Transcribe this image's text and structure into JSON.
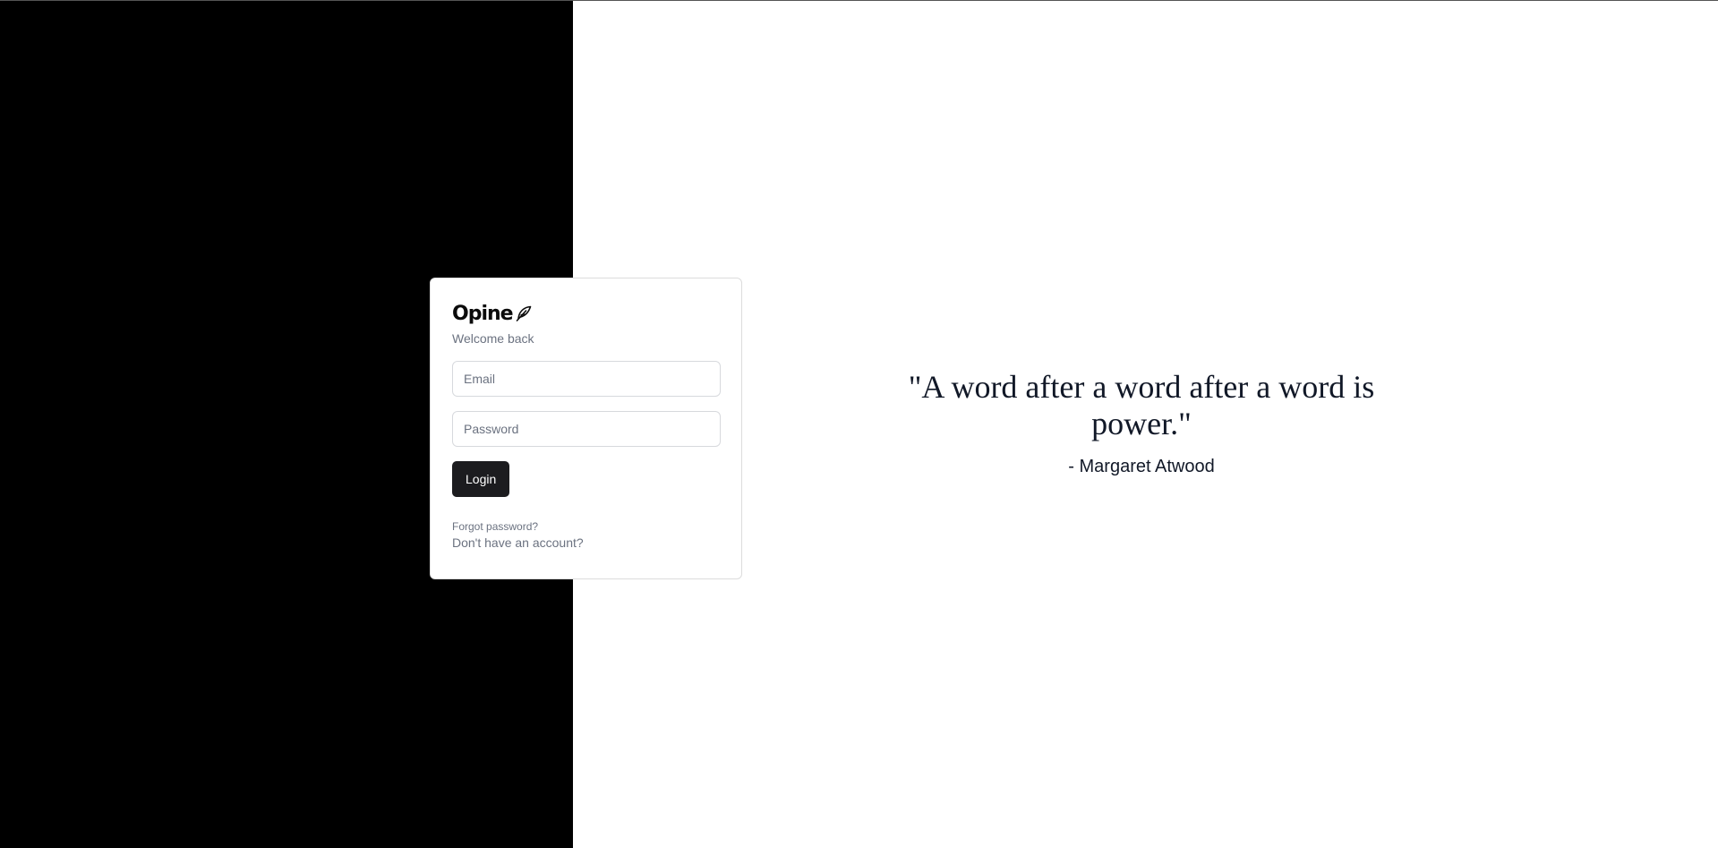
{
  "brand": {
    "name": "Opine",
    "icon": "feather-icon"
  },
  "login": {
    "subtitle": "Welcome back",
    "email": {
      "value": "",
      "placeholder": "Email"
    },
    "password": {
      "value": "",
      "placeholder": "Password"
    },
    "submit_label": "Login",
    "forgot_label": "Forgot password?",
    "signup_label": "Don't have an account?"
  },
  "quote": {
    "text": "\"A word after a word after a word is power.\"",
    "author": "- Margaret Atwood"
  },
  "colors": {
    "left_panel": "#000000",
    "button": "#1c1c1f",
    "muted_text": "#6b7280"
  }
}
